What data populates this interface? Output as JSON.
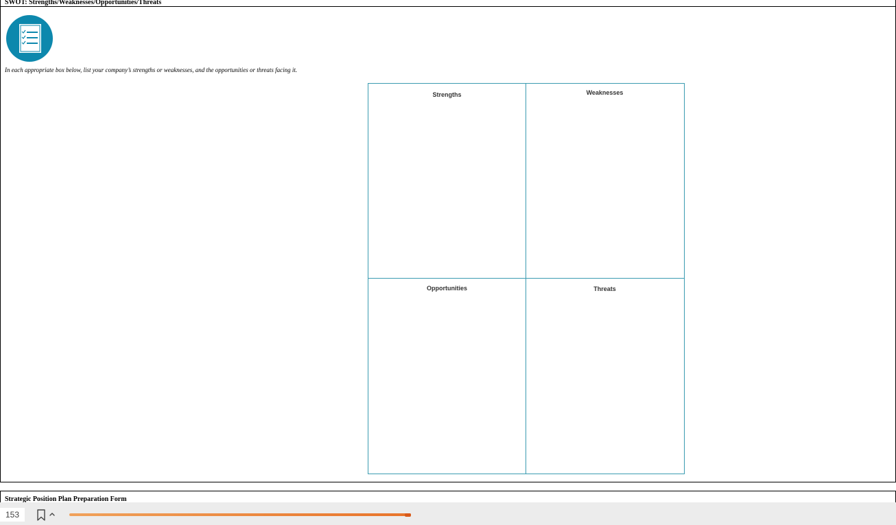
{
  "document": {
    "page1": {
      "header": "SWOT: Strengths/Weaknesses/Opportunities/Threats",
      "icon": "checklist-document-icon",
      "instruction": "In each appropriate box below, list your company’s strengths or weaknesses, and the opportunities or threats facing it.",
      "swot": {
        "strengths": "Strengths",
        "weaknesses": "Weaknesses",
        "opportunities": "Opportunities",
        "threats": "Threats"
      }
    },
    "page2": {
      "header": "Strategic Position Plan Preparation Form"
    }
  },
  "toolbar": {
    "page_number": "153",
    "bookmark_icon": "bookmark-icon",
    "chevron_icon": "chevron-up-icon",
    "progress_fraction": 0.415
  },
  "colors": {
    "accent_teal": "#0d88ad",
    "grid_line": "#3a9bb1",
    "progress_orange": "#e8742a"
  }
}
